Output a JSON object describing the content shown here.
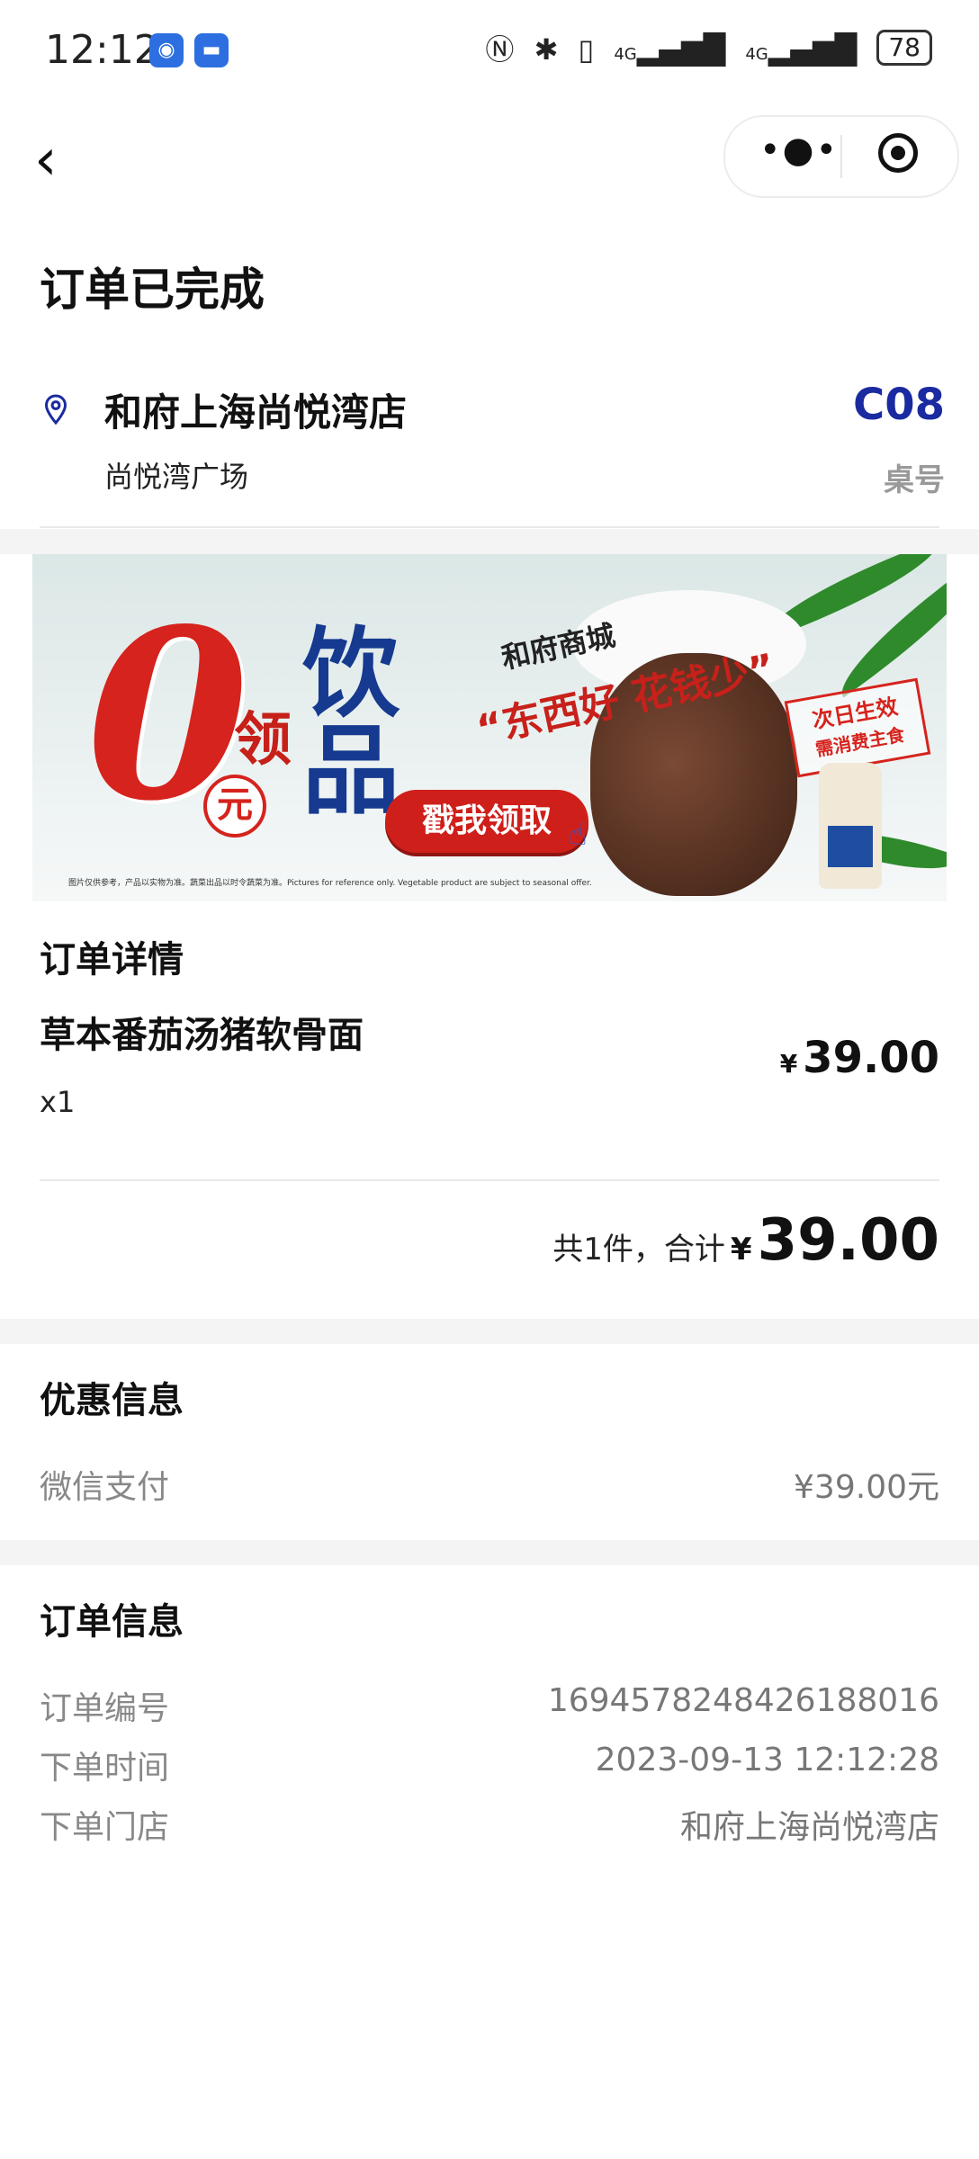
{
  "status_bar": {
    "time": "12:12",
    "battery": "78",
    "network_1": "4G",
    "network_2": "4G",
    "icons": [
      "nfc-icon",
      "bluetooth-icon",
      "vibrate-icon",
      "signal-icon",
      "signal-icon",
      "battery-icon"
    ]
  },
  "nav": {
    "title": "订单已完成"
  },
  "store": {
    "name": "和府上海尚悦湾店",
    "sub": "尚悦湾广场",
    "table_no": "C08",
    "table_label": "桌号"
  },
  "banner": {
    "zero": "0",
    "ling": "领",
    "yuan": "元",
    "yin": "饮",
    "pin": "品",
    "mall": "和府商城",
    "slogan": "“东西好 花钱少”",
    "button": "戳我领取",
    "stamp_line1": "次日生效",
    "stamp_line2": "需消费主食",
    "disclaimer": "图片仅供参考，产品以实物为准。蔬菜出品以时令蔬菜为准。Pictures for reference only. Vegetable product are subject to seasonal offer."
  },
  "order_detail": {
    "title": "订单详情",
    "item_name": "草本番茄汤猪软骨面",
    "item_qty": "x1",
    "item_currency": "¥",
    "item_price": "39.00",
    "total_label": "共1件，合计",
    "total_currency": "¥",
    "total_amount": "39.00"
  },
  "discount": {
    "title": "优惠信息",
    "pay_label": "微信支付",
    "pay_value": "¥39.00元"
  },
  "order_info": {
    "title": "订单信息",
    "rows": [
      {
        "label": "订单编号",
        "value": "1694578248426188016"
      },
      {
        "label": "下单时间",
        "value": "2023-09-13 12:12:28"
      },
      {
        "label": "下单门店",
        "value": "和府上海尚悦湾店"
      }
    ]
  }
}
